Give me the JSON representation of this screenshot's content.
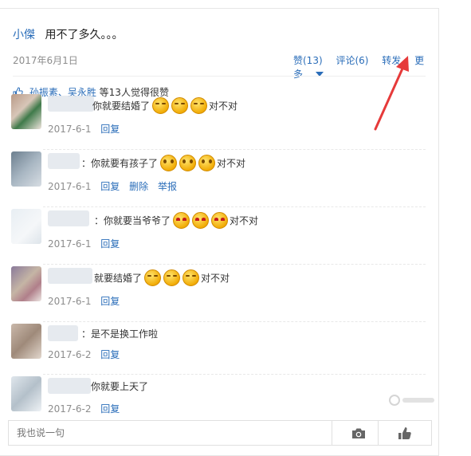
{
  "post": {
    "author": "小傑",
    "text": "用不了多久。。。",
    "date": "2017年6月1日",
    "actions": {
      "like": "赞(13)",
      "comment": "评论(6)",
      "share": "转发",
      "more": "更多"
    }
  },
  "likes": {
    "names": "孙振素、吴永胜",
    "suffix": "等13人觉得很赞"
  },
  "comments": [
    {
      "text": "你就要结婚了",
      "emoji": [
        "grin",
        "grin",
        "grin"
      ],
      "tail": "对不对",
      "date": "2017-6-1",
      "reply": "回复"
    },
    {
      "text": "：你就要有孩子了",
      "emoji": [
        "o",
        "o",
        "o"
      ],
      "tail": "对不对",
      "date": "2017-6-1",
      "reply": "回复",
      "delete": "删除",
      "report": "举报"
    },
    {
      "text": "：你就要当爷爷了",
      "emoji": [
        "h",
        "h",
        "h"
      ],
      "tail": "对不对",
      "date": "2017-6-1",
      "reply": "回复"
    },
    {
      "text": "就要结婚了",
      "emoji": [
        "grin",
        "grin",
        "grin"
      ],
      "tail": "对不对",
      "date": "2017-6-1",
      "reply": "回复"
    },
    {
      "text": "：是不是换工作啦",
      "emoji": [],
      "tail": "",
      "date": "2017-6-2",
      "reply": "回复"
    },
    {
      "text": "你就要上天了",
      "emoji": [],
      "tail": "",
      "date": "2017-6-2",
      "reply": "回复"
    }
  ],
  "reply_bar": {
    "placeholder": "我也说一句"
  },
  "colors": {
    "link": "#2a6db9",
    "arrow": "#e63a3a"
  }
}
